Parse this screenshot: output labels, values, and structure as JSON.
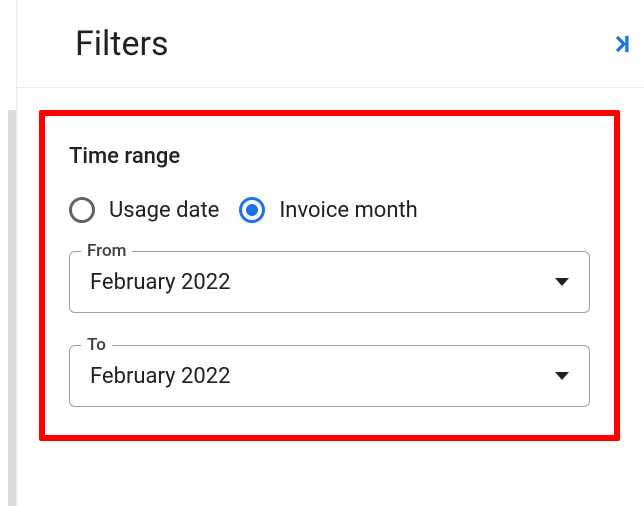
{
  "header": {
    "title": "Filters"
  },
  "filters": {
    "timeRange": {
      "sectionTitle": "Time range",
      "options": {
        "usageDate": {
          "label": "Usage date",
          "selected": false
        },
        "invoiceMonth": {
          "label": "Invoice month",
          "selected": true
        }
      },
      "from": {
        "label": "From",
        "value": "February 2022"
      },
      "to": {
        "label": "To",
        "value": "February 2022"
      }
    }
  }
}
